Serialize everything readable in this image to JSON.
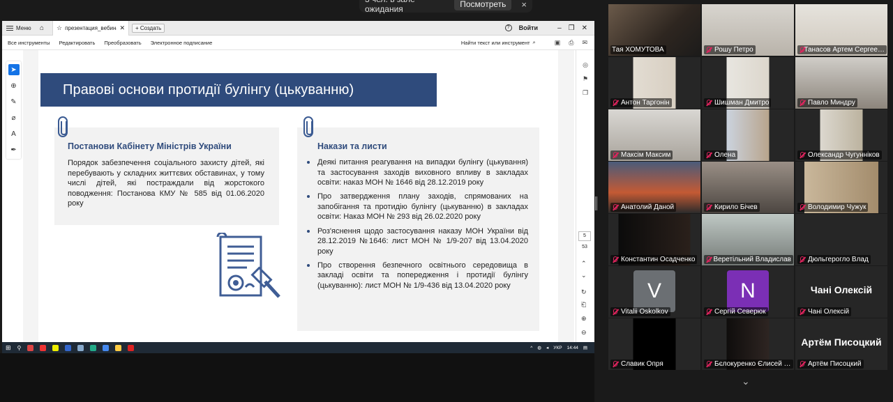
{
  "waiting_banner": {
    "text": "3 чел. в зале ожидания",
    "button": "Посмотреть",
    "close": "×"
  },
  "viewer": {
    "tabbar": {
      "menu_label": "Меню",
      "tab_title": "презентация_вебинар…",
      "new_tab": "+ Создать",
      "signin": "Войти",
      "help": "?"
    },
    "toolbar": {
      "items": [
        "Все инструменты",
        "Редактировать",
        "Преобразовать",
        "Электронное подписание"
      ],
      "search_label": "Найти текст или инструмент"
    },
    "page": {
      "current": "5",
      "total": "53"
    },
    "taskbar": {
      "lang": "УКР",
      "time": "14:44"
    }
  },
  "slide": {
    "title": "Правові основи протидії булінгу (цькуванню)",
    "left_box": {
      "heading": "Постанови Кабінету Міністрів України",
      "text": "Порядок забезпечення соціального захисту дітей, які перебувають у складних життєвих обставинах, у тому числі дітей, які постраждали від жорстокого поводження: Постанова КМУ № 585 від 01.06.2020 року"
    },
    "right_box": {
      "heading": "Накази та листи",
      "items": [
        "Деякі питання реагування на випадки булінгу (цькування) та застосування заходів виховного впливу в закладах освіти: наказ МОН № 1646 від 28.12.2019 року",
        "Про затвердження плану заходів, спрямованих на запобігання та протидію булінгу (цькуванню) в закладах освіти: Наказ МОН № 293 від 26.02.2020 року",
        "Роз'яснення щодо застосування наказу МОН України від 28.12.2019 №1646: лист МОН № 1/9-207 від 13.04.2020 року",
        "Про створення безпечного освітнього середовища в закладі освіти та попередження і протидії булінгу (цькуванню): лист МОН № 1/9-436 від 13.04.2020 року"
      ]
    }
  },
  "participants": [
    {
      "name": "Тая ХОМУТОВА",
      "muted": false,
      "active": true
    },
    {
      "name": "Рошу Петро",
      "muted": true
    },
    {
      "name": "Танасов Артем Сергее…",
      "muted": true
    },
    {
      "name": "Антон Таргонін",
      "muted": true
    },
    {
      "name": "Шишман Дмитро",
      "muted": true
    },
    {
      "name": "Павло Миндру",
      "muted": true
    },
    {
      "name": "Максім Максим",
      "muted": true
    },
    {
      "name": "Олена",
      "muted": true
    },
    {
      "name": "Олександр Чугунніков",
      "muted": true
    },
    {
      "name": "Анатолий Даной",
      "muted": true
    },
    {
      "name": "Кирило Бічев",
      "muted": true
    },
    {
      "name": "Володимир Чужук",
      "muted": true
    },
    {
      "name": "Константин Осадченко",
      "muted": true
    },
    {
      "name": "Веретільний Владислав",
      "muted": true
    },
    {
      "name": "Дюльгерогло Влад",
      "muted": true
    },
    {
      "name": "Vitalii Oskolkov",
      "muted": true,
      "initial": "V",
      "color": "#6b6f73"
    },
    {
      "name": "Сергій Северюк",
      "muted": true,
      "initial": "N",
      "color": "#7b2fb5"
    },
    {
      "name": "Чані Олексій",
      "muted": true,
      "display": "Чані Олексій"
    },
    {
      "name": "Славик Опря",
      "muted": true
    },
    {
      "name": "Бєлокуренко Єлисей …",
      "muted": true
    },
    {
      "name": "Артём Писоцкий",
      "muted": true,
      "display": "Артём Писоцкий"
    }
  ]
}
